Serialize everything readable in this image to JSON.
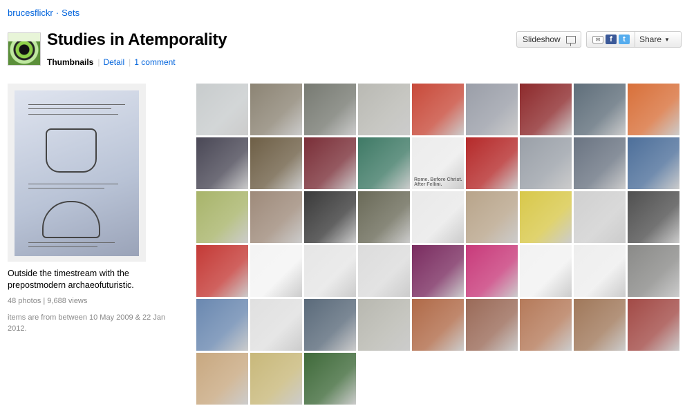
{
  "breadcrumb": {
    "owner": "brucesflickr",
    "section": "Sets"
  },
  "avatar": {
    "label": "synthetic",
    "icon": "avatar-icon"
  },
  "header": {
    "title": "Studies in Atemporality"
  },
  "views": {
    "thumbnails": "Thumbnails",
    "detail": "Detail",
    "comments": "1 comment"
  },
  "actions": {
    "slideshow": "Slideshow",
    "share": "Share"
  },
  "set_info": {
    "description": "Outside the timestream with the prepostmodern archaeofuturistic.",
    "stats": "48 photos | 9,688 views",
    "dates": "items are from between 10 May 2009 & 22 Jan 2012."
  },
  "thumbnails": [
    {
      "color": "#c8cccd",
      "text": ""
    },
    {
      "color": "#8c8474",
      "text": ""
    },
    {
      "color": "#777a72",
      "text": ""
    },
    {
      "color": "#b9b9b3",
      "text": ""
    },
    {
      "color": "#c84a3a",
      "text": ""
    },
    {
      "color": "#9a9ea8",
      "text": ""
    },
    {
      "color": "#8d2a2c",
      "text": ""
    },
    {
      "color": "#5f6e7a",
      "text": ""
    },
    {
      "color": "#d8703a",
      "text": ""
    },
    {
      "color": "#4a4856",
      "text": ""
    },
    {
      "color": "#6e5f46",
      "text": ""
    },
    {
      "color": "#7a2f38",
      "text": ""
    },
    {
      "color": "#3f7a66",
      "text": ""
    },
    {
      "color": "#ececec",
      "text": "Rome. Before Christ. After Fellini."
    },
    {
      "color": "#b52a2a",
      "text": ""
    },
    {
      "color": "#9aa0a8",
      "text": ""
    },
    {
      "color": "#6a7482",
      "text": ""
    },
    {
      "color": "#4d6f9a",
      "text": ""
    },
    {
      "color": "#a8b46a",
      "text": ""
    },
    {
      "color": "#9e8a7a",
      "text": ""
    },
    {
      "color": "#3a3a3a",
      "text": ""
    },
    {
      "color": "#6a6a58",
      "text": ""
    },
    {
      "color": "#e9e9e9",
      "text": ""
    },
    {
      "color": "#b8a48a",
      "text": ""
    },
    {
      "color": "#d8c84a",
      "text": ""
    },
    {
      "color": "#d0d0d0",
      "text": ""
    },
    {
      "color": "#505050",
      "text": ""
    },
    {
      "color": "#c43a36",
      "text": ""
    },
    {
      "color": "#f4f4f4",
      "text": ""
    },
    {
      "color": "#e6e6e6",
      "text": ""
    },
    {
      "color": "#dcdcdc",
      "text": ""
    },
    {
      "color": "#7a2c60",
      "text": ""
    },
    {
      "color": "#c83a7a",
      "text": ""
    },
    {
      "color": "#f2f2f2",
      "text": ""
    },
    {
      "color": "#eeeeee",
      "text": ""
    },
    {
      "color": "#8a8a88",
      "text": ""
    },
    {
      "color": "#6a88b0",
      "text": ""
    },
    {
      "color": "#e0e0e0",
      "text": ""
    },
    {
      "color": "#5a6a7a",
      "text": ""
    },
    {
      "color": "#b8b8b0",
      "text": ""
    },
    {
      "color": "#b06a48",
      "text": ""
    },
    {
      "color": "#9a6a58",
      "text": ""
    },
    {
      "color": "#b57a5a",
      "text": ""
    },
    {
      "color": "#a0785a",
      "text": ""
    },
    {
      "color": "#a24a46",
      "text": ""
    },
    {
      "color": "#c8a880",
      "text": ""
    },
    {
      "color": "#c8b87a",
      "text": ""
    },
    {
      "color": "#3f6a3a",
      "text": ""
    }
  ]
}
